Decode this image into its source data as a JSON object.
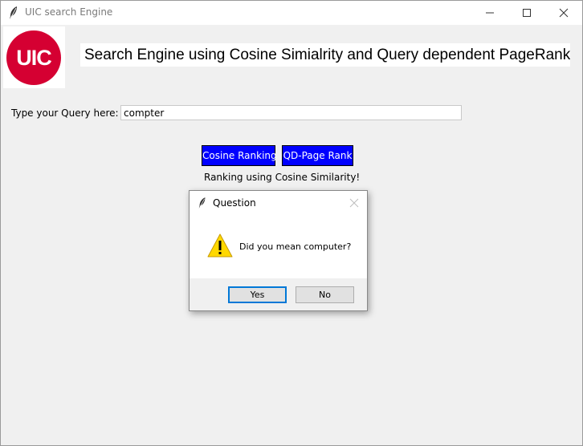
{
  "window": {
    "title": "UIC search Engine",
    "logo_text": "UIC",
    "logo_color": "#d50032"
  },
  "header": {
    "title": "Search Engine using Cosine Simialrity and Query dependent PageRank"
  },
  "query": {
    "label": "Type your Query here:",
    "value": "compter"
  },
  "buttons": {
    "cosine_label": "Cosine Ranking",
    "qd_label": "QD-Page Rank",
    "color": "#0000ff"
  },
  "status": {
    "text": "Ranking using Cosine Similarity!"
  },
  "dialog": {
    "title": "Question",
    "message": "Did you mean computer?",
    "icon": "warning-icon",
    "yes_label": "Yes",
    "no_label": "No"
  }
}
